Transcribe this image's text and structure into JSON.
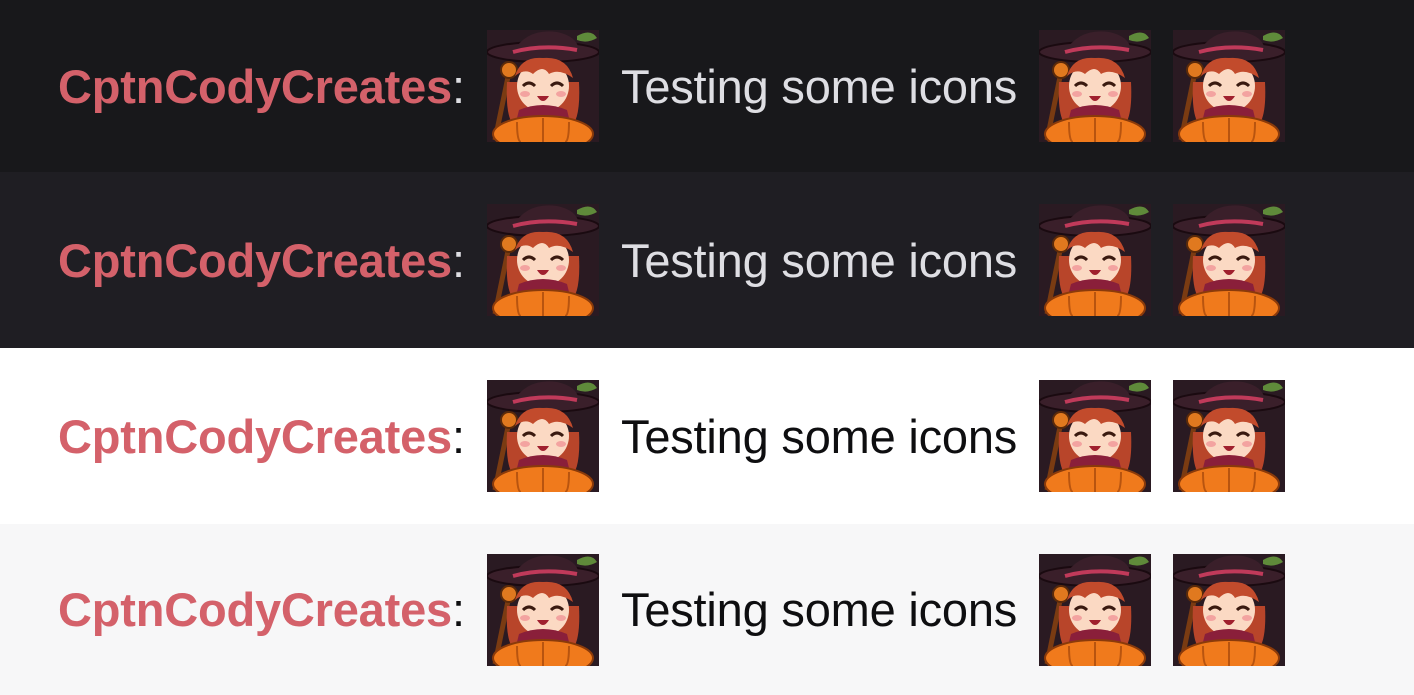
{
  "colors": {
    "username": "#d4616a",
    "row_backgrounds": [
      "#18181b",
      "#1f1e23",
      "#ffffff",
      "#f7f7f8"
    ],
    "dark_text": "#dedee3",
    "light_text": "#0e0e10"
  },
  "messages": [
    {
      "theme": "dark",
      "username": "CptnCodyCreates",
      "separator": ":",
      "text": "Testing some icons",
      "emote": "witch-girl-pumpkin-emote"
    },
    {
      "theme": "dark",
      "username": "CptnCodyCreates",
      "separator": ":",
      "text": "Testing some icons",
      "emote": "witch-girl-pumpkin-emote"
    },
    {
      "theme": "light",
      "username": "CptnCodyCreates",
      "separator": ":",
      "text": "Testing some icons",
      "emote": "witch-girl-pumpkin-emote"
    },
    {
      "theme": "light",
      "username": "CptnCodyCreates",
      "separator": ":",
      "text": "Testing some icons",
      "emote": "witch-girl-pumpkin-emote"
    }
  ]
}
